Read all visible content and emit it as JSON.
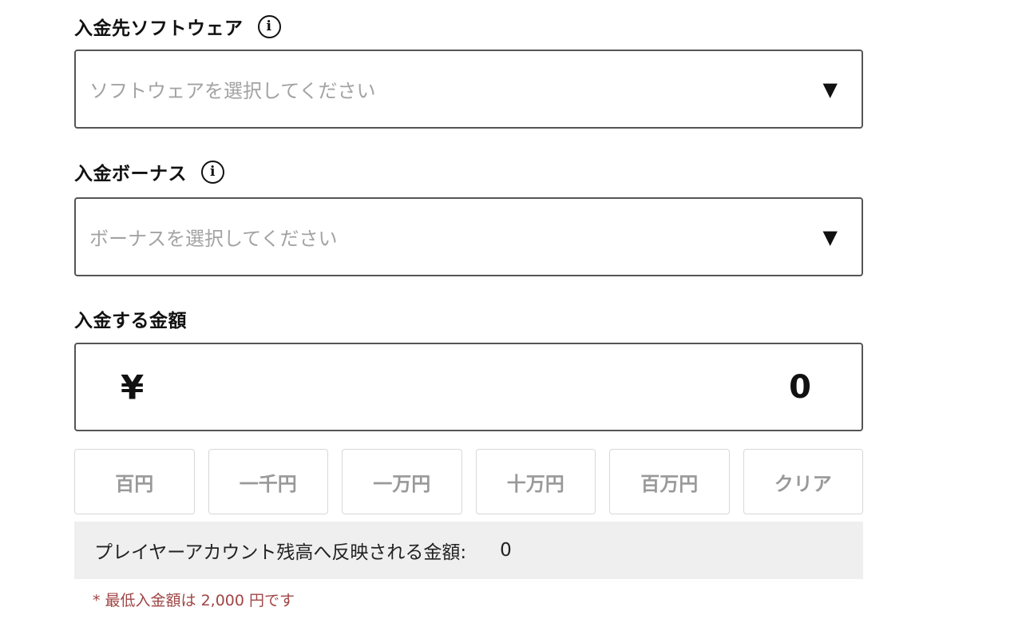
{
  "software": {
    "label": "入金先ソフトウェア",
    "info_icon": "i",
    "placeholder": "ソフトウェアを選択してください",
    "arrow": "▼"
  },
  "bonus": {
    "label": "入金ボーナス",
    "info_icon": "i",
    "placeholder": "ボーナスを選択してください",
    "arrow": "▼"
  },
  "amount": {
    "label": "入金する金額",
    "currency_symbol": "¥",
    "value": "0"
  },
  "quick_buttons": [
    "百円",
    "一千円",
    "一万円",
    "十万円",
    "百万円",
    "クリア"
  ],
  "balance": {
    "label": "プレイヤーアカウント残高へ反映される金額:",
    "value": "0"
  },
  "note": "* 最低入金額は 2,000 円です"
}
